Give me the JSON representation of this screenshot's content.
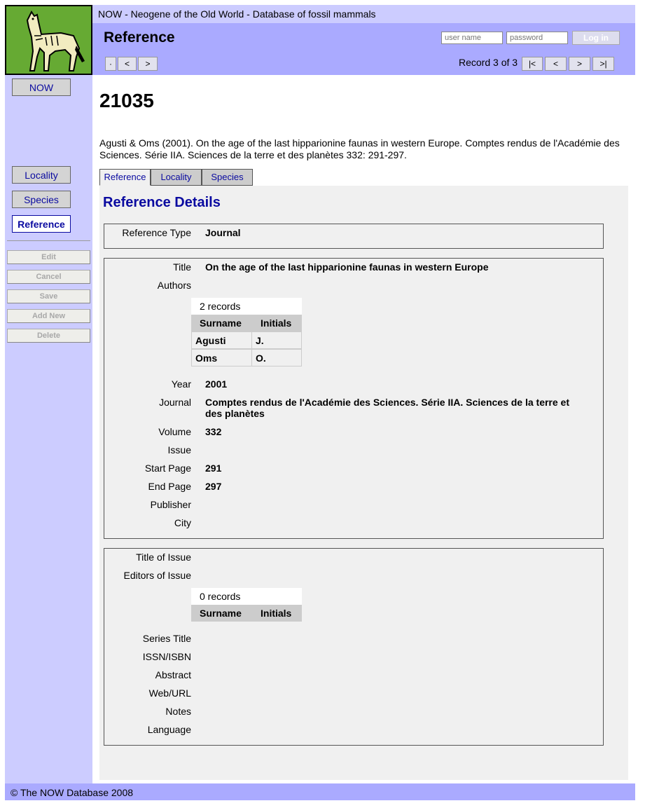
{
  "site": {
    "title": "NOW - Neogene of the Old World - Database of fossil mammals"
  },
  "header": {
    "heading": "Reference",
    "username_placeholder": "user name",
    "password_placeholder": "password",
    "login_label": "Log in",
    "nav_dot": "·",
    "nav_prev": "<",
    "nav_next": ">",
    "record_count": "Record 3 of 3",
    "first": "|<",
    "prev": "<",
    "next": ">",
    "last": ">|"
  },
  "sidebar": {
    "now": "NOW",
    "items": [
      {
        "label": "Locality"
      },
      {
        "label": "Species"
      },
      {
        "label": "Reference"
      }
    ],
    "actions": [
      {
        "label": "Edit"
      },
      {
        "label": "Cancel"
      },
      {
        "label": "Save"
      },
      {
        "label": "Add New"
      },
      {
        "label": "Delete"
      }
    ]
  },
  "record": {
    "id": "21035",
    "citation": "Agusti & Oms (2001). On the age of the last hipparionine faunas in western Europe. Comptes rendus de l'Académie des Sciences. Série IIA. Sciences de la terre et des planètes 332: 291-297."
  },
  "tabs": [
    {
      "label": "Reference"
    },
    {
      "label": "Locality"
    },
    {
      "label": "Species"
    }
  ],
  "details": {
    "section_title": "Reference Details",
    "reference_type": {
      "label": "Reference Type",
      "value": "Journal"
    },
    "title": {
      "label": "Title",
      "value": "On the age of the last hipparionine faunas in western Europe"
    },
    "authors": {
      "label": "Authors",
      "count": "2 records",
      "col_surname": "Surname",
      "col_initials": "Initials",
      "rows": [
        {
          "surname": "Agusti",
          "initials": "J."
        },
        {
          "surname": "Oms",
          "initials": "O."
        }
      ]
    },
    "year": {
      "label": "Year",
      "value": "2001"
    },
    "journal": {
      "label": "Journal",
      "value": "Comptes rendus de l'Académie des Sciences. Série IIA. Sciences de la terre et des planètes"
    },
    "volume": {
      "label": "Volume",
      "value": "332"
    },
    "issue": {
      "label": "Issue",
      "value": ""
    },
    "start_page": {
      "label": "Start Page",
      "value": "291"
    },
    "end_page": {
      "label": "End Page",
      "value": "297"
    },
    "publisher": {
      "label": "Publisher",
      "value": ""
    },
    "city": {
      "label": "City",
      "value": ""
    },
    "title_of_issue": {
      "label": "Title of Issue",
      "value": ""
    },
    "editors": {
      "label": "Editors of Issue",
      "count": "0 records",
      "col_surname": "Surname",
      "col_initials": "Initials"
    },
    "series_title": {
      "label": "Series Title",
      "value": ""
    },
    "issn": {
      "label": "ISSN/ISBN",
      "value": ""
    },
    "abstract": {
      "label": "Abstract",
      "value": ""
    },
    "url": {
      "label": "Web/URL",
      "value": ""
    },
    "notes": {
      "label": "Notes",
      "value": ""
    },
    "language": {
      "label": "Language",
      "value": ""
    }
  },
  "footer": {
    "text": "© The NOW Database 2008"
  },
  "colors": {
    "sidebar": "#ccccff",
    "header": "#aaaaff",
    "link": "#0a0aa0",
    "panel": "#f0f0f0"
  }
}
